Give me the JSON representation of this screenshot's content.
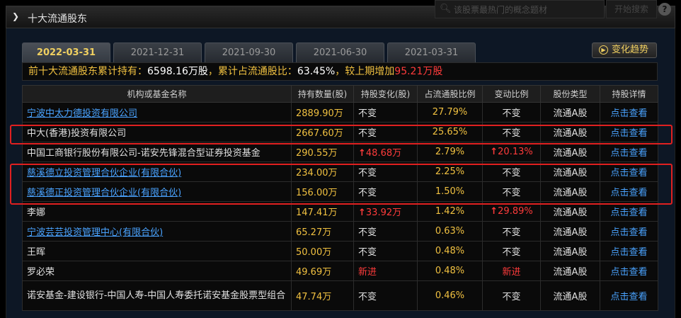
{
  "header": {
    "title": "十大流通股东",
    "search_placeholder": "该股票最热门的概念题材",
    "search_button": "开始搜索",
    "help_label": "?"
  },
  "tabs": [
    {
      "label": "2022-03-31",
      "active": true
    },
    {
      "label": "2021-12-31",
      "active": false
    },
    {
      "label": "2021-09-30",
      "active": false
    },
    {
      "label": "2021-06-30",
      "active": false
    },
    {
      "label": "2021-03-31",
      "active": false
    }
  ],
  "trend_button": "变化趋势",
  "summary": {
    "prefix": "前十大流通股东累计持有：",
    "total": "6598.16万股",
    "mid": "，累计占流通股比：",
    "ratio": "63.45%",
    "suffix": "，较上期增加",
    "increase": "95.21万股"
  },
  "table": {
    "columns": [
      "机构或基金名称",
      "持有数量(股)",
      "持股变化(股)",
      "占流通股比例",
      "变动比例",
      "股份类型",
      "持股详情"
    ],
    "rows": [
      {
        "name": "宁波中太力德投资有限公司",
        "link": true,
        "qty": "2889.90万",
        "change": "不变",
        "change_dir": "",
        "ratio": "27.79%",
        "chg_ratio": "不变",
        "chg_dir": "",
        "type": "流通A股",
        "detail": "点击查看"
      },
      {
        "name": "中大(香港)投资有限公司",
        "link": false,
        "qty": "2667.60万",
        "change": "不变",
        "change_dir": "",
        "ratio": "25.65%",
        "chg_ratio": "不变",
        "chg_dir": "",
        "type": "流通A股",
        "detail": "点击查看"
      },
      {
        "name": "中国工商银行股份有限公司-诺安先锋混合型证券投资基金",
        "link": false,
        "qty": "290.55万",
        "change": "48.68万",
        "change_dir": "up",
        "ratio": "2.79%",
        "chg_ratio": "20.13%",
        "chg_dir": "up",
        "type": "流通A股",
        "detail": "点击查看"
      },
      {
        "name": "慈溪德立投资管理合伙企业(有限合伙)",
        "link": true,
        "qty": "234.00万",
        "change": "不变",
        "change_dir": "",
        "ratio": "2.25%",
        "chg_ratio": "不变",
        "chg_dir": "",
        "type": "流通A股",
        "detail": "点击查看"
      },
      {
        "name": "慈溪德正投资管理合伙企业(有限合伙)",
        "link": true,
        "qty": "156.00万",
        "change": "不变",
        "change_dir": "",
        "ratio": "1.50%",
        "chg_ratio": "不变",
        "chg_dir": "",
        "type": "流通A股",
        "detail": "点击查看"
      },
      {
        "name": "李娜",
        "link": false,
        "qty": "147.41万",
        "change": "33.92万",
        "change_dir": "up",
        "ratio": "1.42%",
        "chg_ratio": "29.89%",
        "chg_dir": "up",
        "type": "流通A股",
        "detail": "点击查看"
      },
      {
        "name": "宁波芸芸投资管理中心(有限合伙)",
        "link": true,
        "qty": "65.27万",
        "change": "不变",
        "change_dir": "",
        "ratio": "0.63%",
        "chg_ratio": "不变",
        "chg_dir": "",
        "type": "流通A股",
        "detail": "点击查看"
      },
      {
        "name": "王晖",
        "link": false,
        "qty": "50.00万",
        "change": "不变",
        "change_dir": "",
        "ratio": "0.48%",
        "chg_ratio": "不变",
        "chg_dir": "",
        "type": "流通A股",
        "detail": "点击查看"
      },
      {
        "name": "罗必荣",
        "link": false,
        "qty": "49.69万",
        "change": "新进",
        "change_dir": "new",
        "ratio": "0.48%",
        "chg_ratio": "新进",
        "chg_dir": "new",
        "type": "流通A股",
        "detail": "点击查看"
      },
      {
        "name": "诺安基金-建设银行-中国人寿-中国人寿委托诺安基金股票型组合",
        "link": false,
        "qty": "47.74万",
        "change": "不变",
        "change_dir": "",
        "ratio": "0.46%",
        "chg_ratio": "不变",
        "chg_dir": "",
        "type": "流通A股",
        "detail": "点击查看"
      }
    ]
  },
  "colors": {
    "accent_gold": "#f0c040",
    "link_blue": "#4aa3ff",
    "up_red": "#ff3b3b",
    "highlight_red": "#e02020"
  }
}
